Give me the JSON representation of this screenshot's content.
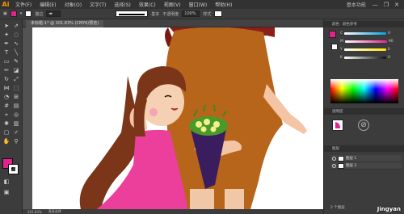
{
  "app": {
    "logo": "Ai",
    "workspace": "基本功能"
  },
  "menu": [
    "文件(F)",
    "编辑(E)",
    "对象(O)",
    "文字(T)",
    "选择(S)",
    "效果(C)",
    "视图(V)",
    "窗口(W)",
    "帮助(H)"
  ],
  "window_controls": [
    "—",
    "❐",
    "✕"
  ],
  "control_bar": {
    "fill_color": "#e4218c",
    "stroke_label": "描边",
    "brush_label": "基本",
    "opacity_label": "不透明度",
    "opacity_value": "100%",
    "style_label": "样式"
  },
  "document_tab": {
    "label": "未标题-1* @ 201.83% (CMYK/预览)"
  },
  "status_bar": {
    "zoom": "201.83%",
    "mode": "直接选择"
  },
  "panels": {
    "color_tab": "颜色",
    "guide_tab": "颜色参考",
    "sliders": [
      {
        "label": "C",
        "value": "0",
        "color": "#00a0e0"
      },
      {
        "label": "M",
        "value": "90",
        "color": "#e4218c"
      },
      {
        "label": "Y",
        "value": "0",
        "color": "#ffe600"
      },
      {
        "label": "K",
        "value": "0",
        "color": "#111111"
      }
    ],
    "appearance_tab": "透明度",
    "layers_tab": "图层",
    "layers": [
      {
        "name": "图层 1"
      },
      {
        "name": "图层 2"
      }
    ],
    "layers_count": "2 个图层"
  },
  "watermark": "Jingyan"
}
